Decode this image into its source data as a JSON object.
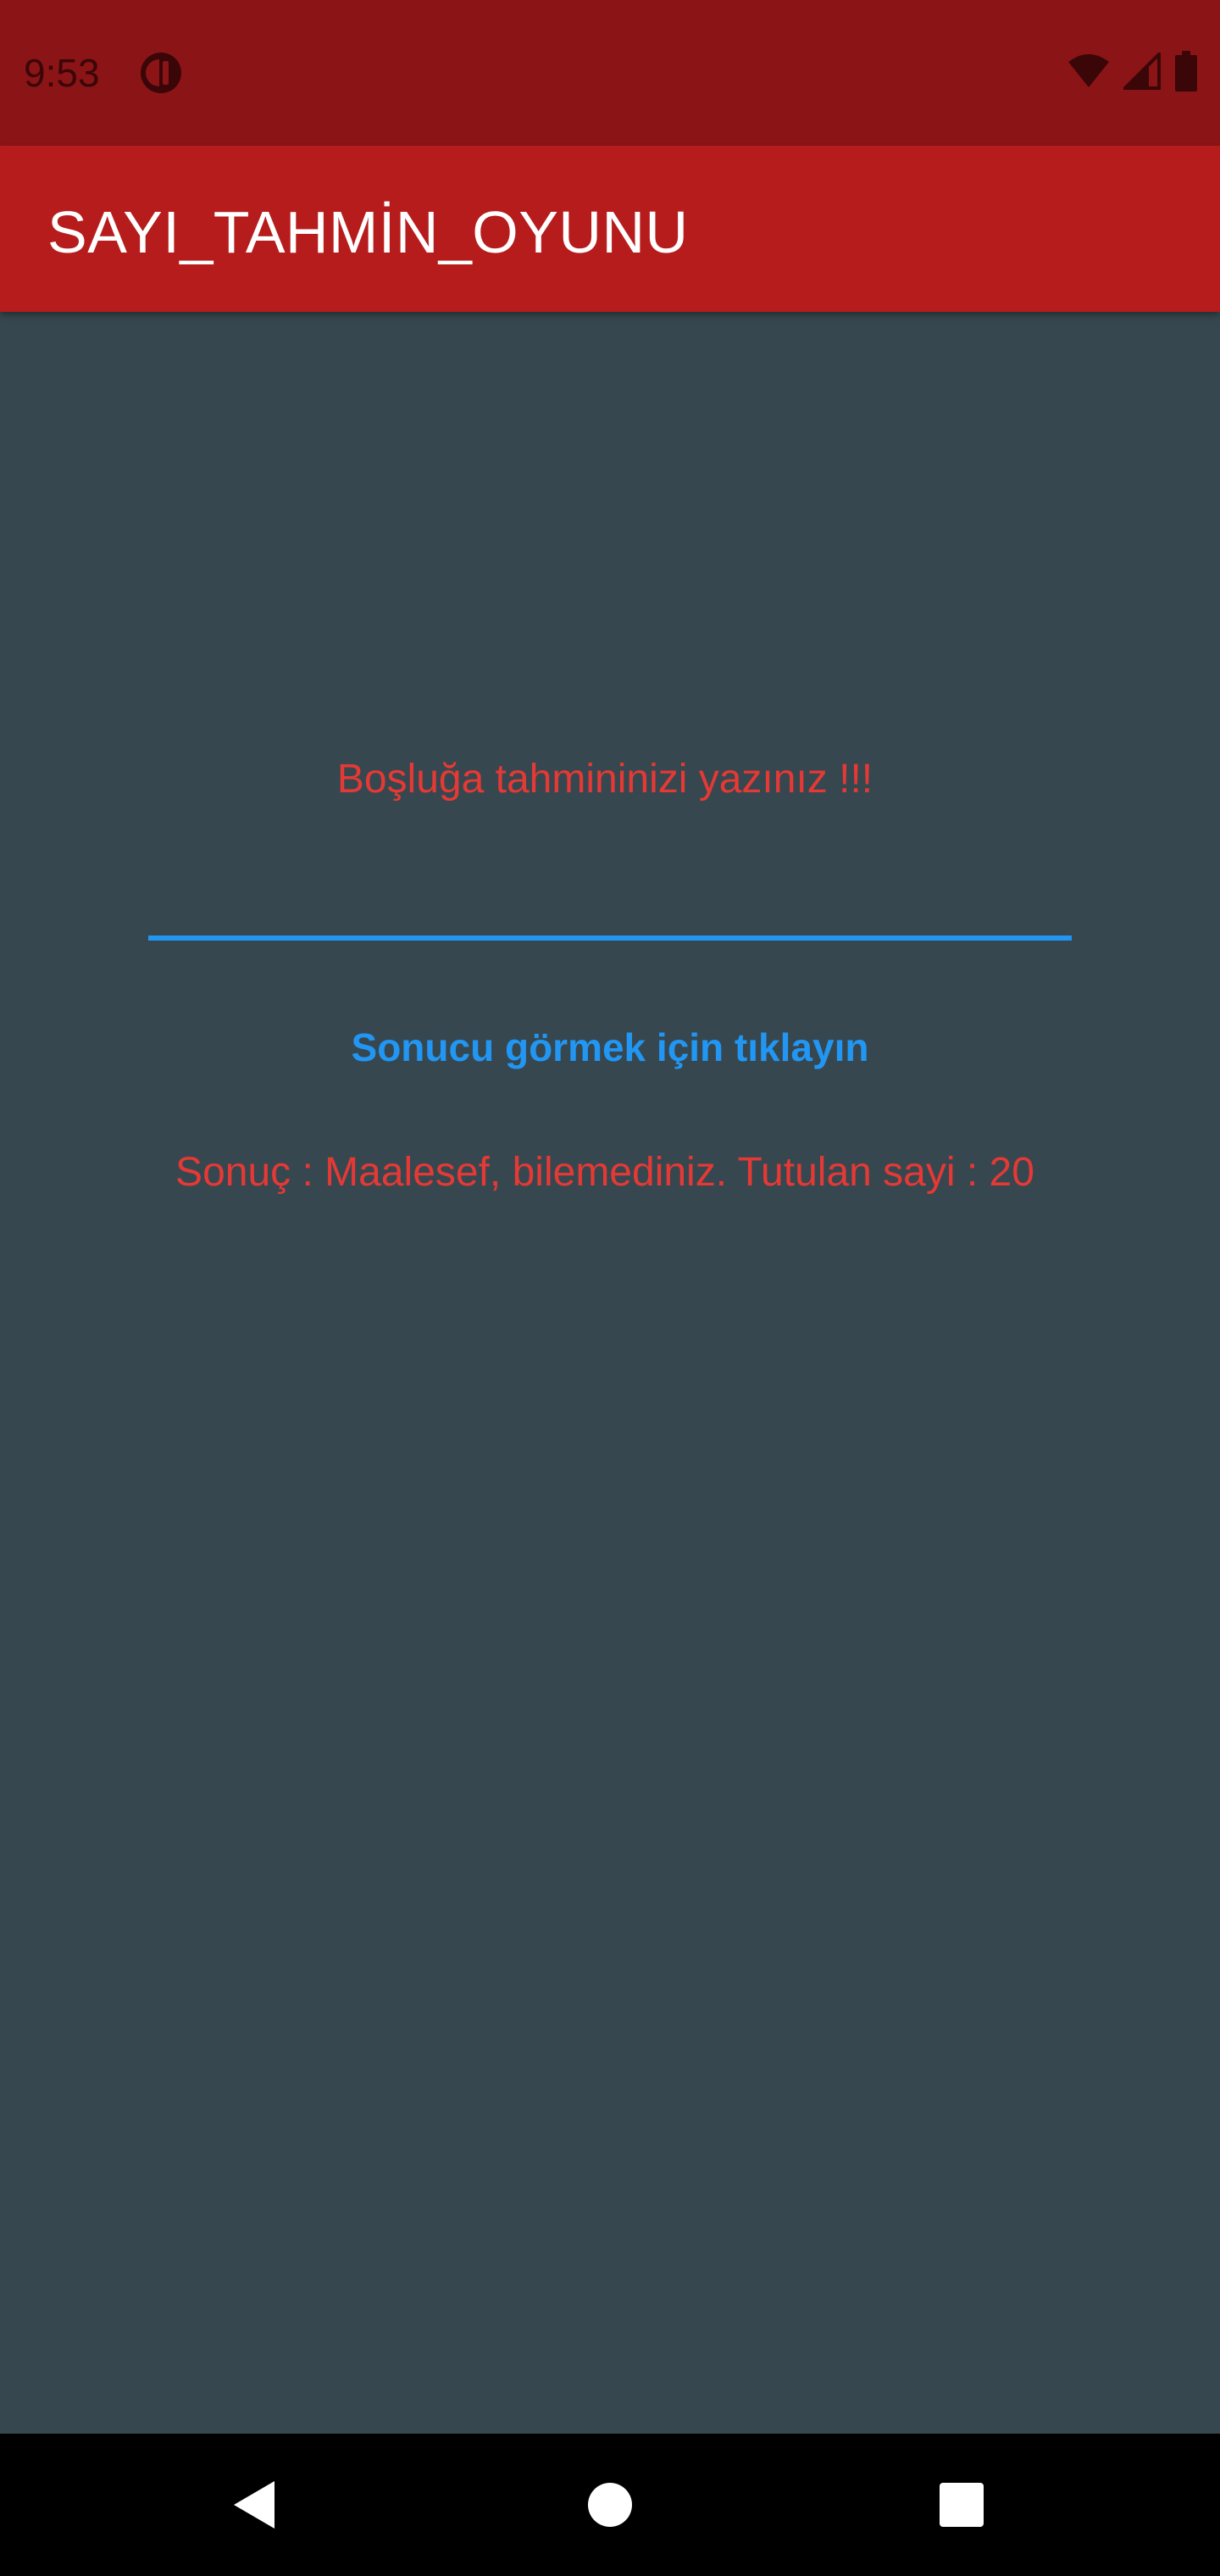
{
  "status_bar": {
    "time": "9:53",
    "icons": [
      "app-notification-icon",
      "wifi-icon",
      "cell-signal-icon",
      "battery-icon"
    ]
  },
  "app_bar": {
    "title": "SAYI_TAHMİN_OYUNU"
  },
  "main": {
    "prompt": "Boşluğa tahmininizi yazınız  !!!",
    "guess_input": {
      "value": "",
      "placeholder": ""
    },
    "result_button_label": "Sonucu görmek için tıklayın",
    "result": "Sonuç : Maalesef, bilemediniz. Tutulan sayi : 20"
  },
  "nav_bar": {
    "buttons": [
      "back-icon",
      "home-icon",
      "recents-icon"
    ]
  },
  "colors": {
    "status_bar": "#8b1417",
    "app_bar": "#b71c1c",
    "background": "#37474f",
    "accent_red": "#e53935",
    "accent_blue": "#2196f3"
  }
}
